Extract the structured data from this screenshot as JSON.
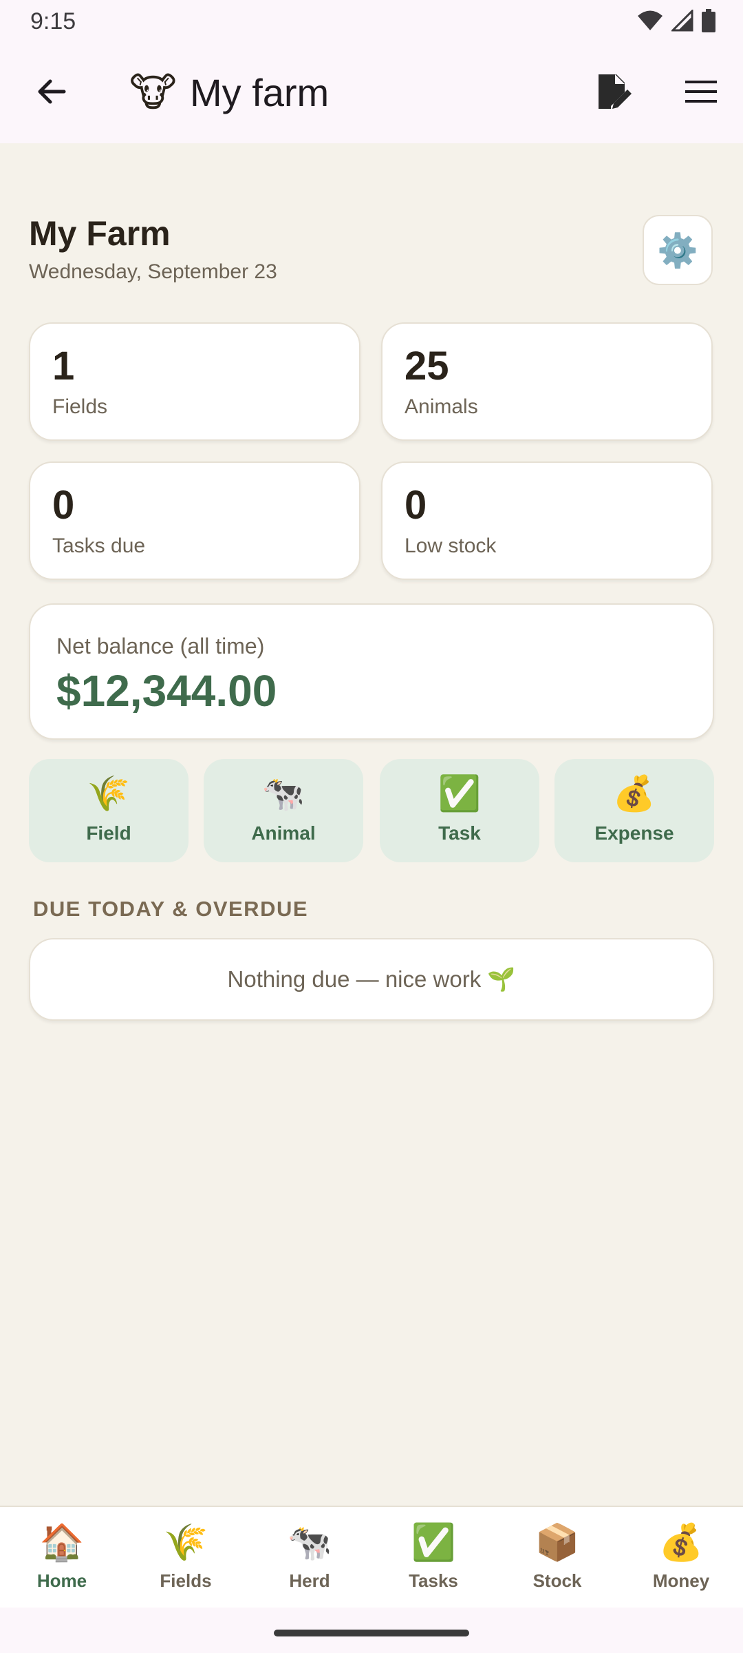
{
  "status_bar": {
    "time": "9:15"
  },
  "app_bar": {
    "logo": "🐮",
    "title": "My farm"
  },
  "header": {
    "title": "My Farm",
    "date": "Wednesday, September 23",
    "settings_icon": "⚙️"
  },
  "stats": [
    {
      "value": "1",
      "label": "Fields"
    },
    {
      "value": "25",
      "label": "Animals"
    },
    {
      "value": "0",
      "label": "Tasks due"
    },
    {
      "value": "0",
      "label": "Low stock"
    }
  ],
  "balance": {
    "label": "Net balance (all time)",
    "value": "$12,344.00"
  },
  "actions": [
    {
      "icon": "🌾",
      "label": "Field"
    },
    {
      "icon": "🐄",
      "label": "Animal"
    },
    {
      "icon": "✅",
      "label": "Task"
    },
    {
      "icon": "💰",
      "label": "Expense"
    }
  ],
  "due_section": {
    "title": "DUE TODAY & OVERDUE",
    "empty_text": "Nothing due — nice work 🌱"
  },
  "bottom_nav": [
    {
      "icon": "🏠",
      "label": "Home",
      "active": true
    },
    {
      "icon": "🌾",
      "label": "Fields"
    },
    {
      "icon": "🐄",
      "label": "Herd"
    },
    {
      "icon": "✅",
      "label": "Tasks"
    },
    {
      "icon": "📦",
      "label": "Stock"
    },
    {
      "icon": "💰",
      "label": "Money"
    }
  ],
  "colors": {
    "accent": "#3f6b4c",
    "background": "#f5f2ea",
    "chip": "#e2ede4",
    "bar": "#fcf6fb"
  }
}
